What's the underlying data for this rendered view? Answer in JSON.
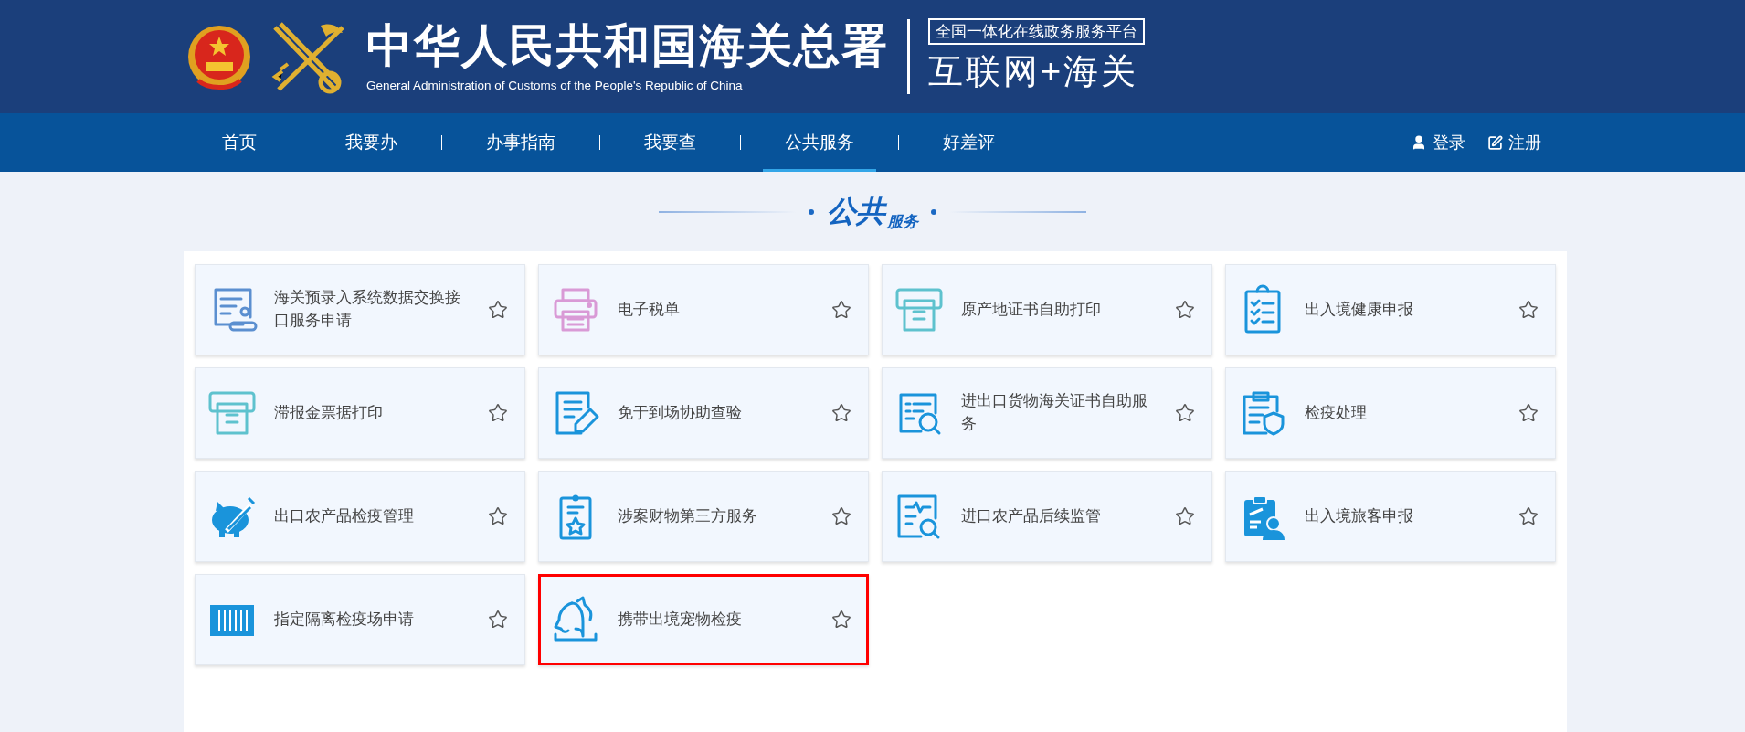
{
  "header": {
    "title": "中华人民共和国海关总署",
    "subtitle": "General Administration of Customs of the People's Republic of China",
    "platform_caption": "全国一体化在线政务服务平台",
    "platform_name": "互联网+海关"
  },
  "nav": {
    "items": [
      {
        "label": "首页",
        "selected": false
      },
      {
        "label": "我要办",
        "selected": false
      },
      {
        "label": "办事指南",
        "selected": false
      },
      {
        "label": "我要查",
        "selected": false
      },
      {
        "label": "公共服务",
        "selected": true
      },
      {
        "label": "好差评",
        "selected": false
      }
    ],
    "login": "登录",
    "register": "注册"
  },
  "section": {
    "title_main": "公共",
    "title_sub": "服务"
  },
  "cards": [
    {
      "label": "海关预录入系统数据交换接口服务申请",
      "favorited": false,
      "highlighted": false
    },
    {
      "label": "电子税单",
      "favorited": false,
      "highlighted": false
    },
    {
      "label": "原产地证书自助打印",
      "favorited": false,
      "highlighted": false
    },
    {
      "label": "出入境健康申报",
      "favorited": false,
      "highlighted": false
    },
    {
      "label": "滞报金票据打印",
      "favorited": false,
      "highlighted": false
    },
    {
      "label": "免于到场协助查验",
      "favorited": false,
      "highlighted": false
    },
    {
      "label": "进出口货物海关证书自助服务",
      "favorited": false,
      "highlighted": false
    },
    {
      "label": "检疫处理",
      "favorited": false,
      "highlighted": false
    },
    {
      "label": "出口农产品检疫管理",
      "favorited": false,
      "highlighted": false
    },
    {
      "label": "涉案财物第三方服务",
      "favorited": false,
      "highlighted": false
    },
    {
      "label": "进口农产品后续监管",
      "favorited": false,
      "highlighted": false
    },
    {
      "label": "出入境旅客申报",
      "favorited": false,
      "highlighted": false
    },
    {
      "label": "指定隔离检疫场申请",
      "favorited": false,
      "highlighted": false
    },
    {
      "label": "携带出境宠物检疫",
      "favorited": false,
      "highlighted": true
    }
  ]
}
